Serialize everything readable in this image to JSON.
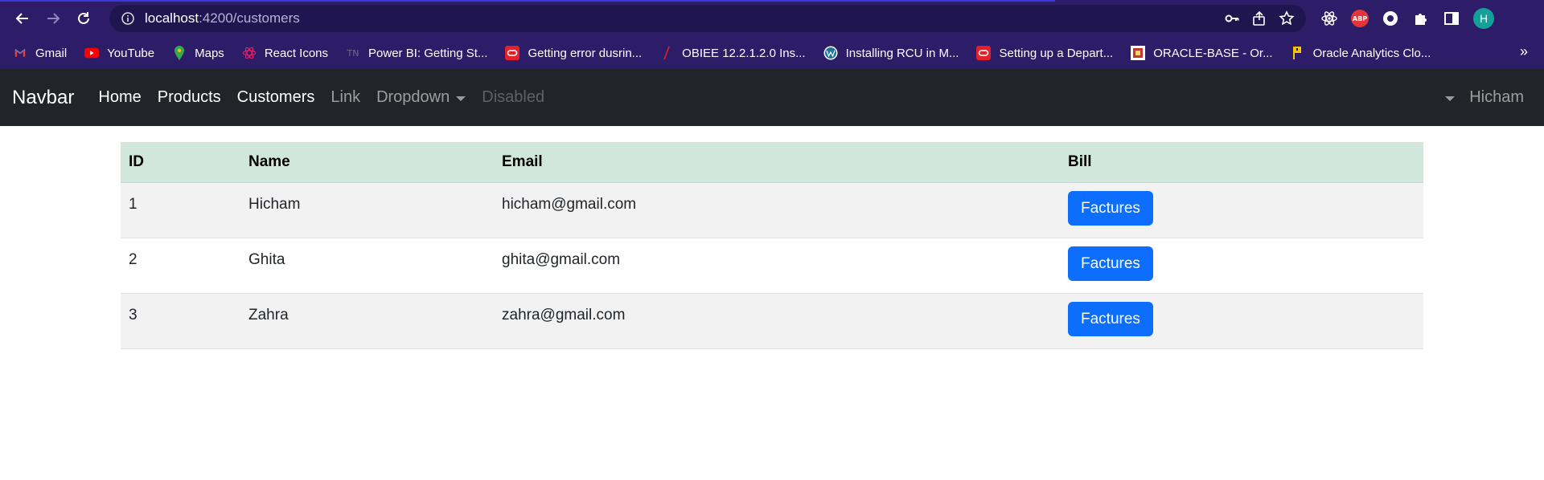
{
  "browser": {
    "url_host": "localhost",
    "url_path": ":4200/customers",
    "profile_initial": "H",
    "abp_label": "ABP",
    "bookmarks": [
      {
        "label": "Gmail",
        "icon": "gmail-icon"
      },
      {
        "label": "YouTube",
        "icon": "youtube-icon"
      },
      {
        "label": "Maps",
        "icon": "maps-icon"
      },
      {
        "label": "React Icons",
        "icon": "react-icon"
      },
      {
        "label": "Power BI: Getting St...",
        "icon": "tn-icon",
        "icon_text": "TN"
      },
      {
        "label": "Getting error dusrin...",
        "icon": "oracle-icon"
      },
      {
        "label": "OBIEE 12.2.1.2.0 Ins...",
        "icon": "slash-icon"
      },
      {
        "label": "Installing RCU in M...",
        "icon": "wordpress-icon"
      },
      {
        "label": "Setting up a Depart...",
        "icon": "oracle-icon"
      },
      {
        "label": "ORACLE-BASE - Or...",
        "icon": "oraclebase-icon"
      },
      {
        "label": "Oracle Analytics Clo...",
        "icon": "flag-icon"
      }
    ],
    "more_label": "»"
  },
  "navbar": {
    "brand": "Navbar",
    "links": [
      "Home",
      "Products",
      "Customers",
      "Link"
    ],
    "dropdown": "Dropdown",
    "disabled": "Disabled",
    "user": "Hicham"
  },
  "table": {
    "headers": [
      "ID",
      "Name",
      "Email",
      "Bill"
    ],
    "rows": [
      {
        "id": "1",
        "name": "Hicham",
        "email": "hicham@gmail.com",
        "button": "Factures"
      },
      {
        "id": "2",
        "name": "Ghita",
        "email": "ghita@gmail.com",
        "button": "Factures"
      },
      {
        "id": "3",
        "name": "Zahra",
        "email": "zahra@gmail.com",
        "button": "Factures"
      }
    ]
  },
  "colors": {
    "chrome_bg": "#2d1d68",
    "navbar_bg": "#212529",
    "header_row": "#d1e7dd",
    "primary_button": "#0d6efd"
  }
}
